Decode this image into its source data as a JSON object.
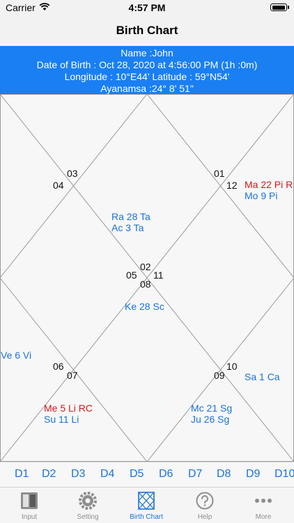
{
  "status_bar": {
    "carrier": "Carrier",
    "time": "4:57 PM",
    "battery_level": 1.0
  },
  "nav": {
    "title": "Birth Chart"
  },
  "info": {
    "name": "Name :John",
    "dob": "Date of Birth : Oct 28, 2020 at 4:56:00 PM (1h :0m)",
    "coords": "Longitude : 10°E44' Latitude : 59°N54'",
    "ayanamsa": "Ayanamsa :24° 8' 51\""
  },
  "chart": {
    "house_numbers": [
      "01",
      "02",
      "03",
      "04",
      "05",
      "06",
      "07",
      "08",
      "09",
      "10",
      "11",
      "12"
    ],
    "planets": {
      "ma": "Ma 22 Pi R",
      "mo": "Mo 9 Pi",
      "ra": "Ra 28 Ta",
      "ac": "Ac 3 Ta",
      "ke": "Ke 28 Sc",
      "ve": "Ve 6 Vi",
      "sa": "Sa 1 Ca",
      "me": "Me 5 Li RC",
      "su": "Su 11 Li",
      "mc": "Mc 21 Sg",
      "ju": "Ju 26 Sg"
    },
    "colors": {
      "retro": "#d11a1a",
      "planet": "#1a73d9"
    }
  },
  "divisional_tabs": [
    "D1",
    "D2",
    "D3",
    "D4",
    "D5",
    "D6",
    "D7",
    "D8",
    "D9",
    "D10"
  ],
  "tabbar": {
    "items": [
      {
        "label": "Input",
        "icon": "book-icon"
      },
      {
        "label": "Setting",
        "icon": "gear-icon"
      },
      {
        "label": "Birth Chart",
        "icon": "chart-grid-icon"
      },
      {
        "label": "Help",
        "icon": "help-icon"
      },
      {
        "label": "More",
        "icon": "more-icon"
      }
    ],
    "accent": "#1a73d9"
  }
}
